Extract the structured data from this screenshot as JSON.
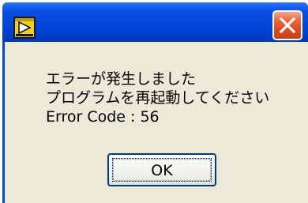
{
  "dialog": {
    "icons": {
      "app": "labview-run-icon",
      "close": "close-icon"
    },
    "message_lines": [
      "エラーが発生しました",
      "プログラムを再起動してください",
      "Error Code : 56"
    ],
    "ok_label": "OK"
  },
  "colors": {
    "titlebar": "#0046d8",
    "close_button": "#d94a20",
    "dialog_body": "#ece9d8",
    "text": "#000000"
  }
}
